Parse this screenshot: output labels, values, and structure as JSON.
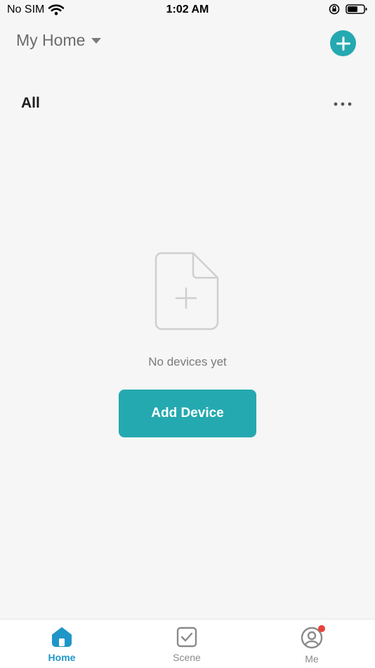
{
  "status_bar": {
    "carrier": "No SIM",
    "time": "1:02 AM"
  },
  "header": {
    "home_name": "My Home"
  },
  "section": {
    "title": "All"
  },
  "empty_state": {
    "message": "No devices yet",
    "button_label": "Add Device"
  },
  "tab_bar": {
    "tabs": [
      {
        "label": "Home",
        "icon": "home-icon",
        "active": true
      },
      {
        "label": "Scene",
        "icon": "scene-checkbox-icon",
        "active": false
      },
      {
        "label": "Me",
        "icon": "profile-icon",
        "active": false,
        "badge": true
      }
    ]
  },
  "colors": {
    "accent": "#25a9b0",
    "active_tab": "#1f96c8",
    "badge": "#e8413c"
  }
}
